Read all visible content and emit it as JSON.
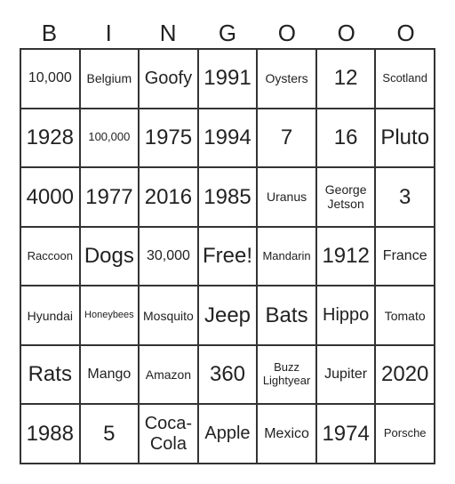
{
  "header": {
    "letters": [
      "B",
      "I",
      "N",
      "G",
      "O",
      "O",
      "O"
    ]
  },
  "board": {
    "rows": [
      [
        "10,000",
        "Belgium",
        "Goofy",
        "1991",
        "Oysters",
        "12",
        "Scotland"
      ],
      [
        "1928",
        "100,000",
        "1975",
        "1994",
        "7",
        "16",
        "Pluto"
      ],
      [
        "4000",
        "1977",
        "2016",
        "1985",
        "Uranus",
        "George\nJetson",
        "3"
      ],
      [
        "Raccoon",
        "Dogs",
        "30,000",
        "Free!",
        "Mandarin",
        "1912",
        "France"
      ],
      [
        "Hyundai",
        "Honeybees",
        "Mosquito",
        "Jeep",
        "Bats",
        "Hippo",
        "Tomato"
      ],
      [
        "Rats",
        "Mango",
        "Amazon",
        "360",
        "Buzz\nLightyear",
        "Jupiter",
        "2020"
      ],
      [
        "1988",
        "5",
        "Coca-\nCola",
        "Apple",
        "Mexico",
        "1974",
        "Porsche"
      ]
    ]
  },
  "colors": {
    "grid_line": "#333333",
    "text": "#222222",
    "background": "#ffffff"
  }
}
